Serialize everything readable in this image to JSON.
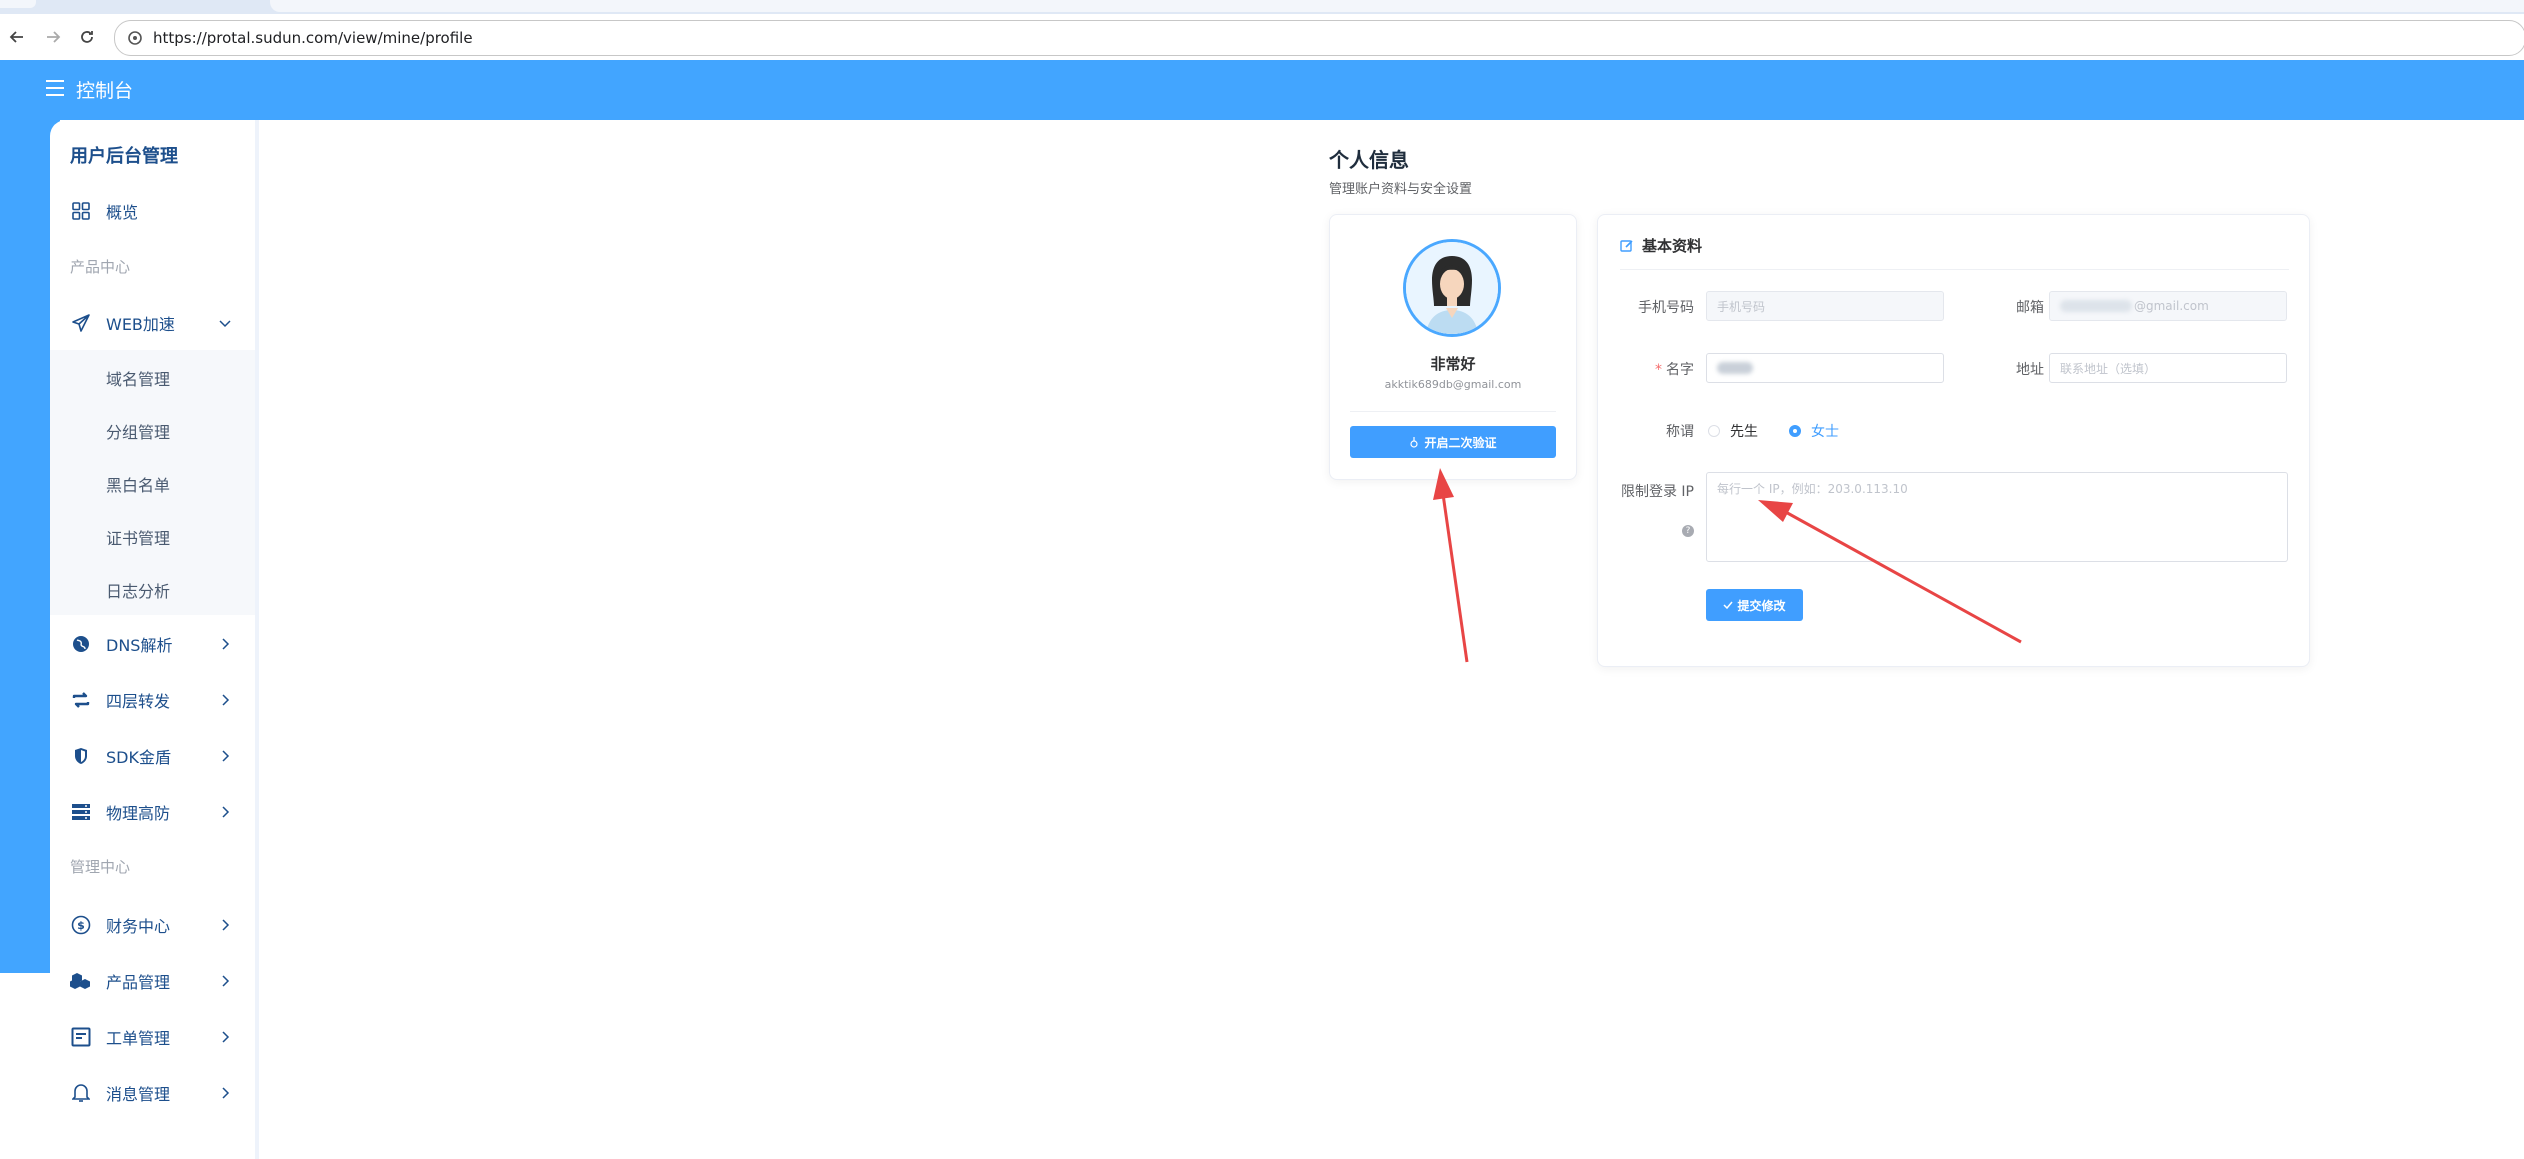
{
  "browser": {
    "url": "https://protal.sudun.com/view/mine/profile"
  },
  "header": {
    "title": "控制台"
  },
  "sidebar": {
    "title": "用户后台管理",
    "overview": "概览",
    "section_product": "产品中心",
    "web_accel": "WEB加速",
    "sub_items": [
      "域名管理",
      "分组管理",
      "黑白名单",
      "证书管理",
      "日志分析"
    ],
    "dns": "DNS解析",
    "l4": "四层转发",
    "sdk": "SDK金盾",
    "physical": "物理高防",
    "section_manage": "管理中心",
    "finance": "财务中心",
    "product_mgmt": "产品管理",
    "tickets": "工单管理",
    "messages": "消息管理"
  },
  "page": {
    "title": "个人信息",
    "subtitle": "管理账户资料与安全设置"
  },
  "profile": {
    "nickname": "非常好",
    "email": "akktik689db@gmail.com",
    "twofa_button": "开启二次验证"
  },
  "basic": {
    "section_title": "基本资料",
    "phone_label": "手机号码",
    "phone_placeholder": "手机号码",
    "email_label": "邮箱",
    "email_value_suffix": "@gmail.com",
    "name_label": "名字",
    "address_label": "地址",
    "address_placeholder": "联系地址（选填）",
    "salutation_label": "称谓",
    "salutation_options": [
      "先生",
      "女士"
    ],
    "salutation_selected": "女士",
    "ip_label": "限制登录 IP",
    "ip_placeholder": "每行一个 IP，例如：203.0.113.10",
    "submit_button": "提交修改"
  },
  "colors": {
    "primary": "#409eff",
    "header": "#42a5ff",
    "annotation_arrow": "#e84545"
  }
}
